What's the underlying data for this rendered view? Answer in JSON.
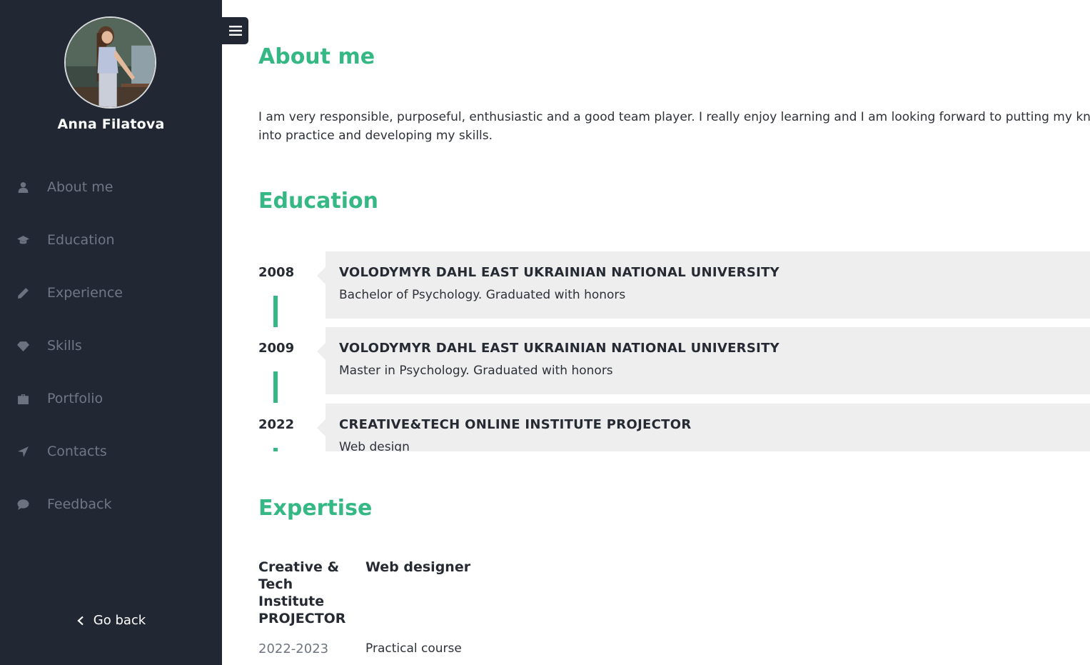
{
  "profile": {
    "name": "Anna Filatova"
  },
  "nav": [
    {
      "label": "About me",
      "icon": "user-icon"
    },
    {
      "label": "Education",
      "icon": "graduation-cap-icon"
    },
    {
      "label": "Experience",
      "icon": "pencil-icon"
    },
    {
      "label": "Skills",
      "icon": "diamond-icon"
    },
    {
      "label": "Portfolio",
      "icon": "briefcase-icon"
    },
    {
      "label": "Contacts",
      "icon": "location-arrow-icon"
    },
    {
      "label": "Feedback",
      "icon": "comment-icon"
    }
  ],
  "go_back": "Go back",
  "about": {
    "title": "About me",
    "text": "I am very responsible, purposeful, enthusiastic and a good team player. I really enjoy learning and I am looking forward to putting my knowledge into practice and developing my skills."
  },
  "education": {
    "title": "Education",
    "items": [
      {
        "year": "2008",
        "title": "VOLODYMYR DAHL EAST UKRAINIAN NATIONAL UNIVERSITY",
        "desc": "Bachelor of Psychology. Graduated with honors"
      },
      {
        "year": "2009",
        "title": "VOLODYMYR DAHL EAST UKRAINIAN NATIONAL UNIVERSITY",
        "desc": "Master in Psychology. Graduated with honors"
      },
      {
        "year": "2022",
        "title": "CREATIVE&TECH ONLINE INSTITUTE PROJECTOR",
        "desc": "Web design"
      }
    ]
  },
  "expertise": {
    "title": "Expertise",
    "org": "Creative & Tech Institute PROJECTOR",
    "role": "Web designer",
    "period": "2022-2023",
    "type": "Practical course"
  },
  "colors": {
    "accent": "#35b884",
    "sidebar": "#222833",
    "card": "#eeeeee"
  }
}
